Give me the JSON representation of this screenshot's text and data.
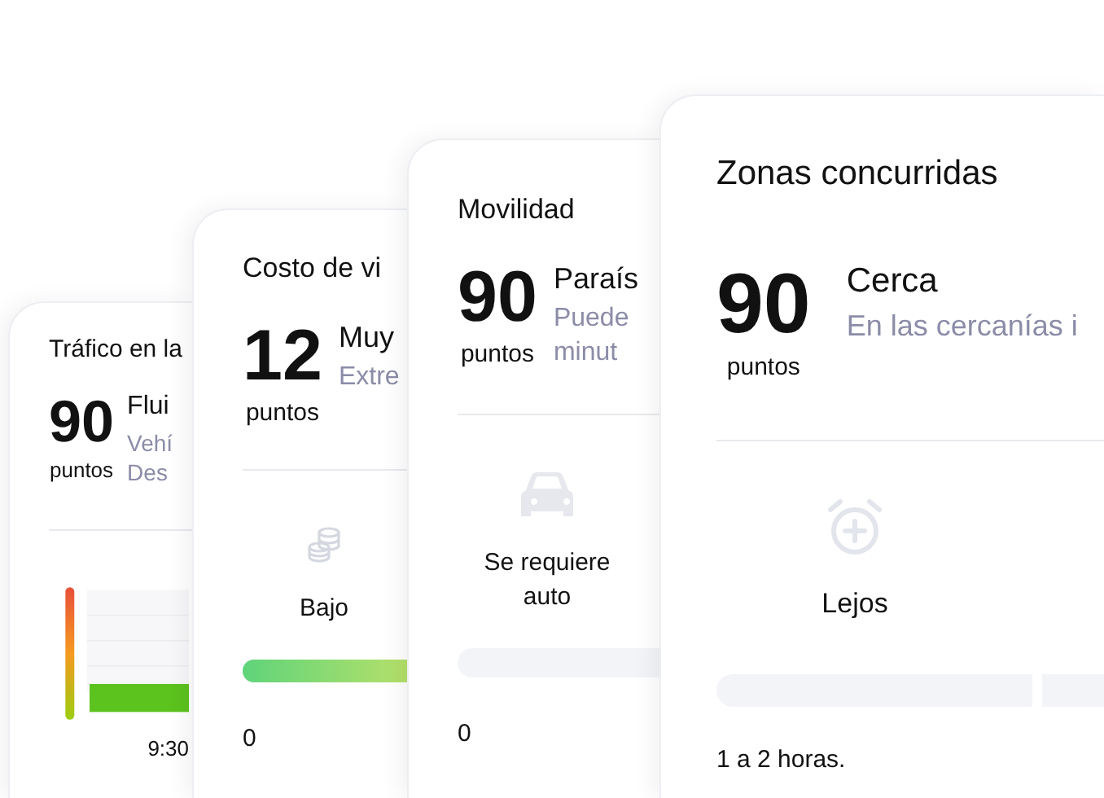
{
  "cards": [
    {
      "kind": "traffic",
      "title": "Tráfico en la",
      "score": "90",
      "unit": "puntos",
      "status": "Flui",
      "hint": [
        "Vehí",
        "Des"
      ],
      "axis_label": "9:30"
    },
    {
      "kind": "meter",
      "title": "Costo de vi",
      "score": "12",
      "unit": "puntos",
      "status": "Muy",
      "hint": [
        "Extre"
      ],
      "label": "Bajo",
      "level": 1,
      "reading": "0"
    },
    {
      "kind": "meter",
      "title": "Movilidad",
      "score": "90",
      "unit": "puntos",
      "status": "Paraís",
      "hint": [
        "Puede",
        "minut"
      ],
      "label": "Se requiere auto",
      "level": 0,
      "reading": "0"
    },
    {
      "kind": "segments",
      "title": "Zonas concurridas",
      "score": "90",
      "unit": "puntos",
      "status": "Cerca",
      "hint": [
        "En las cercanías i"
      ],
      "label": "Lejos",
      "reading": "1 a 2 horas."
    }
  ]
}
